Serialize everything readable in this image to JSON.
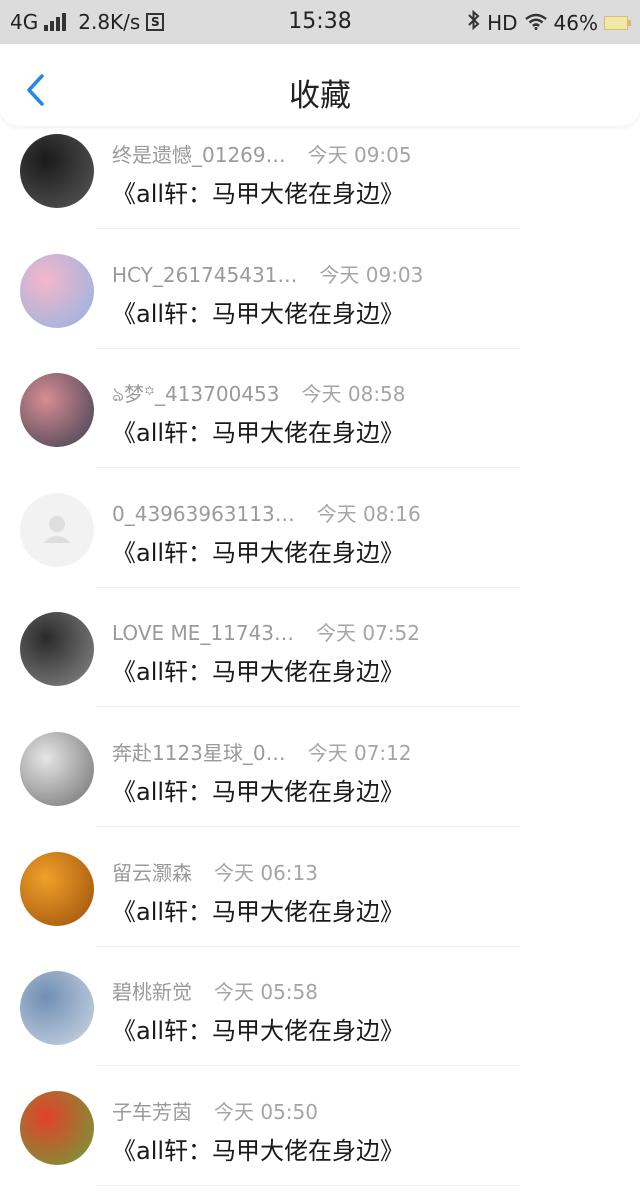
{
  "status_bar": {
    "network": "4G",
    "speed": "2.8K/s",
    "time": "15:38",
    "hd": "HD",
    "battery": "46%"
  },
  "header": {
    "title": "收藏"
  },
  "items": [
    {
      "name": "终是遗憾_01269…",
      "time": "今天 09:05",
      "content": "《all轩：马甲大佬在身边》",
      "avatar_colors": [
        "#1a1a1a",
        "#5a5a5a"
      ]
    },
    {
      "name": "HCY_261745431…",
      "time": "今天 09:03",
      "content": "《all轩：马甲大佬在身边》",
      "avatar_colors": [
        "#f4b6c9",
        "#8fb4e3"
      ]
    },
    {
      "name": "ঌ梦꙳_413700453",
      "time": "今天 08:58",
      "content": "《all轩：马甲大佬在身边》",
      "avatar_colors": [
        "#d98c93",
        "#39404f"
      ]
    },
    {
      "name": "0_43963963113…",
      "time": "今天 08:16",
      "content": "《all轩：马甲大佬在身边》",
      "avatar_colors": [
        "#f2f2f2",
        "#f2f2f2"
      ]
    },
    {
      "name": "LOVE ME_11743…",
      "time": "今天 07:52",
      "content": "《all轩：马甲大佬在身边》",
      "avatar_colors": [
        "#2a2a2a",
        "#8a8a8a"
      ]
    },
    {
      "name": "奔赴1123星球_0…",
      "time": "今天 07:12",
      "content": "《all轩：马甲大佬在身边》",
      "avatar_colors": [
        "#e6e6e6",
        "#6e6e6e"
      ]
    },
    {
      "name": "留云灏森",
      "time": "今天 06:13",
      "content": "《all轩：马甲大佬在身边》",
      "avatar_colors": [
        "#f0a12a",
        "#9a4d0a"
      ]
    },
    {
      "name": "碧桃新觉",
      "time": "今天 05:58",
      "content": "《all轩：马甲大佬在身边》",
      "avatar_colors": [
        "#6f8fb3",
        "#cfd8e6"
      ]
    },
    {
      "name": "子车芳茵",
      "time": "今天 05:50",
      "content": "《all轩：马甲大佬在身边》",
      "avatar_colors": [
        "#e3412a",
        "#6aa13a"
      ]
    }
  ]
}
